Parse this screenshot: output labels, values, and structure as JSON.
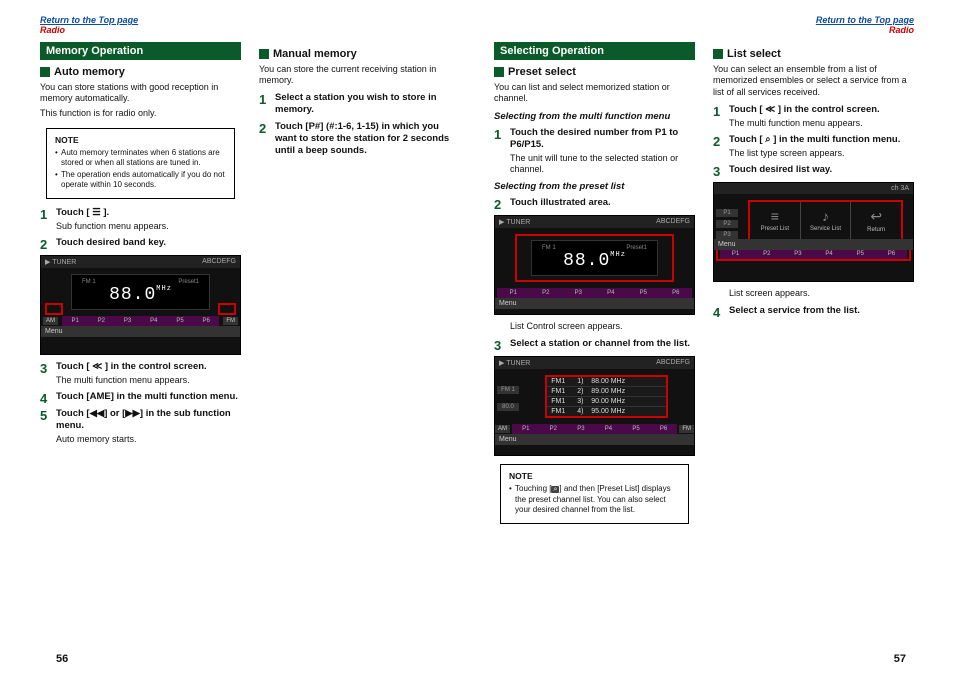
{
  "header": {
    "toplink": "Return to the Top page",
    "radio": "Radio"
  },
  "left": {
    "section": "Memory Operation",
    "automem": {
      "title": "Auto memory",
      "p1": "You can store stations with good reception in memory automatically.",
      "p2": "This function is for radio only.",
      "note_title": "NOTE",
      "notes": [
        "Auto memory terminates when 6 stations are stored or when all stations are tuned in.",
        "The operation ends automatically if you do not operate within 10 seconds."
      ],
      "steps": [
        {
          "main": "Touch [ ☰ ].",
          "sub": "Sub function menu appears."
        },
        {
          "main": "Touch desired band key.",
          "sub": ""
        },
        {
          "main": "Touch [ ≪ ] in the control screen.",
          "sub": "The multi function menu appears."
        },
        {
          "main": "Touch [AME] in the multi function menu.",
          "sub": ""
        },
        {
          "main": "Touch [◀◀] or [▶▶] in the sub function menu.",
          "sub": "Auto memory starts."
        }
      ]
    },
    "manual": {
      "title": "Manual memory",
      "p1": "You can store the current receiving station in memory.",
      "steps": [
        {
          "main": "Select a station you wish to store in memory.",
          "sub": ""
        },
        {
          "main": "Touch [P#] (#:1-6, 1-15) in which you want to store the station for 2 seconds until a beep sounds.",
          "sub": ""
        }
      ]
    },
    "page_no": "56"
  },
  "right": {
    "section": "Selecting Operation",
    "preset": {
      "title": "Preset select",
      "p1": "You can list and select memorized station or channel.",
      "sub1": "Selecting from the multi function menu",
      "step1": {
        "main": "Touch the desired number from P1 to P6/P15.",
        "sub": "The unit will tune to the selected station or channel."
      },
      "sub2": "Selecting from the preset list",
      "step2": {
        "main": "Touch illustrated area.",
        "sub": ""
      },
      "caption2": "List Control screen appears.",
      "step3": {
        "main": "Select a station or channel from the list.",
        "sub": ""
      },
      "note_title": "NOTE",
      "note_text_a": "Touching [",
      "note_text_b": "] and then [Preset List] displays the preset channel list. You can also select your desired channel from the list."
    },
    "listsel": {
      "title": "List select",
      "p1": "You can select an ensemble from a list of memorized ensembles or select a service from a list of all services received.",
      "steps": [
        {
          "main": "Touch [ ≪ ] in the control screen.",
          "sub": "The multi function menu appears."
        },
        {
          "main": "Touch [ ⌕ ] in the multi function menu.",
          "sub": "The list type screen appears."
        },
        {
          "main": "Touch desired list way.",
          "sub": ""
        }
      ],
      "caption": "List screen appears.",
      "step4": {
        "main": "Select a service from the list.",
        "sub": ""
      }
    },
    "page_no": "57"
  },
  "screens": {
    "tuner_label": "TUNER",
    "abc": "ABCDEFG",
    "fm1": "FM 1",
    "preset1": "Preset1",
    "freq": "88.0",
    "unit": "MHz",
    "presets": [
      "P1",
      "P2",
      "P3",
      "P4",
      "P5",
      "P6"
    ],
    "menu": "Menu",
    "am": "AM",
    "fm": "FM",
    "listrows": [
      {
        "c1": "FM1",
        "c2": "1)",
        "c3": "88.00 MHz"
      },
      {
        "c1": "FM1",
        "c2": "2)",
        "c3": "89.00 MHz"
      },
      {
        "c1": "FM1",
        "c2": "3)",
        "c3": "90.00 MHz"
      },
      {
        "c1": "FM1",
        "c2": "4)",
        "c3": "95.00 MHz"
      }
    ],
    "sidefreq": "80.0",
    "ch": "ch 3A",
    "iconpanel": [
      {
        "ic": "≡",
        "label": "Preset List"
      },
      {
        "ic": "♪",
        "label": "Service List"
      },
      {
        "ic": "↩",
        "label": "Return"
      }
    ],
    "icon_sidebar": [
      "P1",
      "P2",
      "P3"
    ]
  }
}
